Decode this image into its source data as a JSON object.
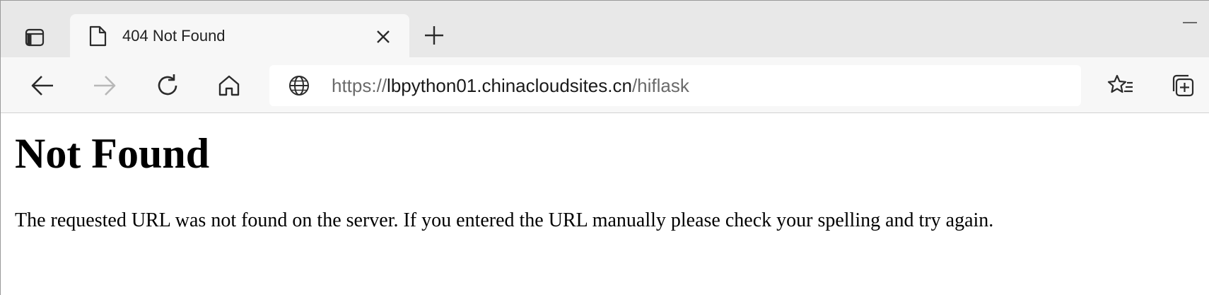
{
  "tab": {
    "title": "404 Not Found"
  },
  "address_bar": {
    "scheme": "https://",
    "host": "lbpython01.chinacloudsites.cn",
    "path": "/hiflask"
  },
  "page": {
    "heading": "Not Found",
    "message": "The requested URL was not found on the server. If you entered the URL manually please check your spelling and try again."
  },
  "icons": {
    "tab_actions": "tab-actions-icon",
    "tab_page": "page-icon",
    "tab_close": "close-icon",
    "new_tab": "plus-icon",
    "minimize": "minimize-icon",
    "back": "arrow-left-icon",
    "forward": "arrow-right-icon",
    "refresh": "refresh-icon",
    "home": "home-icon",
    "site_info": "globe-icon",
    "favorites": "favorites-icon",
    "collections": "collections-icon"
  },
  "colors": {
    "tabstrip_bg": "#e8e8e8",
    "toolbar_bg": "#f7f7f7",
    "icon": "#2b2b2b",
    "icon_disabled": "#b8b8b8",
    "url_dim": "#6a6a6a",
    "url_host": "#1a1a1a"
  }
}
